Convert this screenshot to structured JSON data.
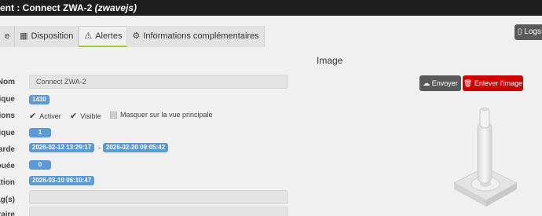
{
  "titlebar": {
    "prefix": "ent : Connect ZWA-2 ",
    "suffix": "(zwavejs)"
  },
  "tabs": [
    {
      "label": "e",
      "icon": "none"
    },
    {
      "label": "Disposition",
      "icon": "table-icon"
    },
    {
      "label": "Alertes",
      "icon": "warning-icon"
    },
    {
      "label": "Informations complémentaires",
      "icon": "cogs-icon"
    }
  ],
  "logs_button": {
    "label": "Logs",
    "icon": "file-icon"
  },
  "image_section": {
    "heading": "Image",
    "upload_label": "Envoyer",
    "remove_label": "Enlever l'image"
  },
  "form": {
    "rows": [
      {
        "label": "Nom"
      },
      {
        "label": "ique"
      },
      {
        "label": "tions"
      },
      {
        "label": "gique"
      },
      {
        "label": "garde"
      },
      {
        "label": "ouée"
      },
      {
        "label": "ation"
      },
      {
        "label": "ag(s)"
      },
      {
        "label": "taire"
      }
    ],
    "name_value": "Connect ZWA-2",
    "id_badge": "1430",
    "options": {
      "activate": "Activer",
      "visible": "Visible",
      "hide_main": "Masquer sur la vue principale"
    },
    "logic_badge": "1",
    "backup_from": "2026-02-12 13:29:17",
    "backup_to": "2026-02-20 09:05:42",
    "dash": "-",
    "failed_badge": "0",
    "creation_badge": "2026-03-10 06:10:47"
  }
}
